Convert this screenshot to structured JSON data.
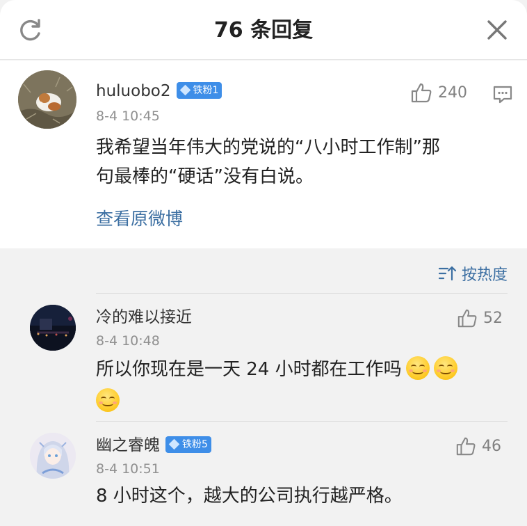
{
  "header": {
    "title": "76 条回复"
  },
  "post": {
    "username": "huluobo2",
    "badge": "铁粉1",
    "time": "8-4 10:45",
    "likes": "240",
    "content_line1": "我希望当年伟大的党说的“八小时工作制”那",
    "content_line2": "句最棒的“硬话”没有白说。",
    "view_original": "查看原微博"
  },
  "sort": {
    "label": "按热度"
  },
  "replies": [
    {
      "username": "冷的难以接近",
      "time": "8-4 10:48",
      "likes": "52",
      "text": "所以你现在是一天 24 小时都在工作吗"
    },
    {
      "username": "幽之睿魄",
      "badge": "铁粉5",
      "time": "8-4 10:51",
      "likes": "46",
      "text": "8 小时这个，越大的公司执行越严格。"
    }
  ],
  "colors": {
    "link": "#3c6fa2",
    "badge": "#3e8ee8",
    "muted": "#909090",
    "background": "#f2f2f2"
  },
  "icons": [
    "refresh-icon",
    "close-icon",
    "thumbs-up-icon",
    "comment-icon",
    "sort-icon",
    "smile-emoji-icon"
  ]
}
